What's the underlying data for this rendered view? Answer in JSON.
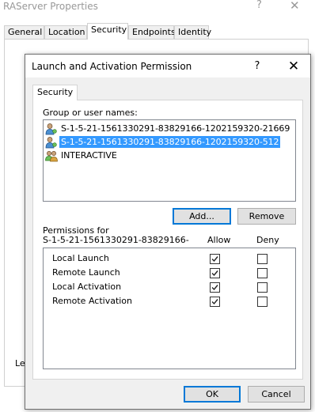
{
  "background_window": {
    "title": "RAServer Properties",
    "help_glyph": "?",
    "close_glyph": "✕",
    "tabs": [
      {
        "label": "General",
        "active": false
      },
      {
        "label": "Location",
        "active": false
      },
      {
        "label": "Security",
        "active": true
      },
      {
        "label": "Endpoints",
        "active": false
      },
      {
        "label": "Identity",
        "active": false
      }
    ],
    "partial_label": "Le"
  },
  "dialog": {
    "title": "Launch and Activation Permission",
    "help_glyph": "?",
    "close_glyph": "✕",
    "tab_label": "Security",
    "group_label": "Group or user names:",
    "users": [
      {
        "name": "S-1-5-21-1561330291-83829166-1202159320-21669",
        "icon": "user-icon",
        "selected": false
      },
      {
        "name": "S-1-5-21-1561330291-83829166-1202159320-512",
        "icon": "user-group-icon",
        "selected": true
      },
      {
        "name": "INTERACTIVE",
        "icon": "users-group-icon",
        "selected": false
      }
    ],
    "add_button": "Add...",
    "remove_button": "Remove",
    "permissions_for_label": "Permissions for",
    "permissions_for_subject": "S-1-5-21-1561330291-83829166-",
    "allow_header": "Allow",
    "deny_header": "Deny",
    "permissions": [
      {
        "name": "Local Launch",
        "allow": true,
        "deny": false
      },
      {
        "name": "Remote Launch",
        "allow": true,
        "deny": false
      },
      {
        "name": "Local Activation",
        "allow": true,
        "deny": false
      },
      {
        "name": "Remote Activation",
        "allow": true,
        "deny": false
      }
    ],
    "ok_button": "OK",
    "cancel_button": "Cancel"
  },
  "colors": {
    "selection": "#3399ff",
    "focus_border": "#0078d7",
    "dialog_bg": "#f0f0f0"
  }
}
